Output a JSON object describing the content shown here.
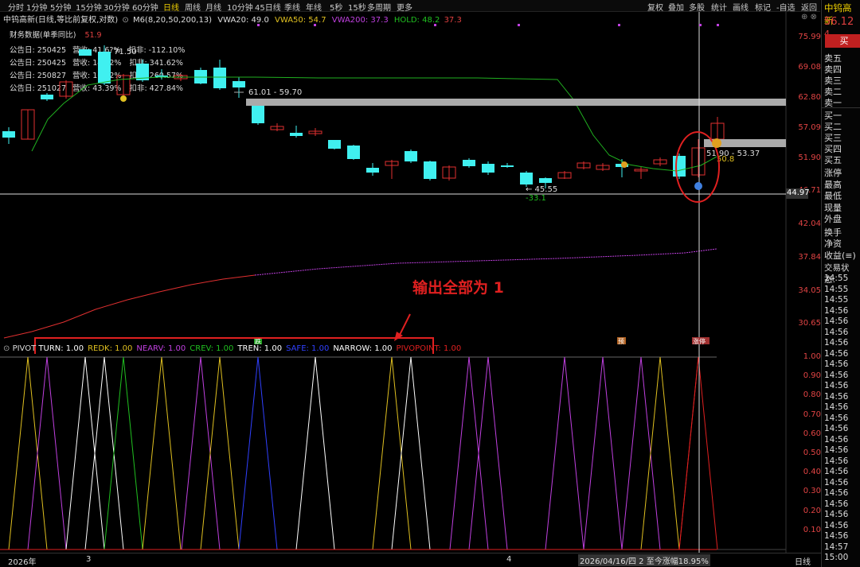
{
  "toolbar": {
    "left_items": [
      "分时",
      "1分钟",
      "5分钟",
      "15分钟",
      "30分钟",
      "60分钟",
      "日线",
      "周线",
      "月线",
      "10分钟",
      "45日线",
      "季线",
      "年线",
      "5秒",
      "15秒",
      "多周期",
      "更多"
    ],
    "active": "日线",
    "right_items": [
      "复权",
      "叠加",
      "多股",
      "统计",
      "画线",
      "标记",
      "-自选",
      "返回"
    ]
  },
  "chart_header": {
    "title": "中钨高新(日线,等比前复权,对数)",
    "indicator": "M6(8,20,50,200,13)",
    "vwa20": "VWA20: 49.0",
    "vwa50": "VWA50: 54.7",
    "vwa200": "VWA200: 37.3",
    "hold": "HOLD: 48.2",
    "hold2": "37.3"
  },
  "financial": {
    "title": "财务数据(单季同比)",
    "value": "51.9",
    "rows": [
      {
        "date": "公告日: 250425",
        "rev": "营收: 41.6?%",
        "deduct": "扣非: -112.10%"
      },
      {
        "date": "公告日: 250425",
        "rev": "营收: 14.52%",
        "deduct": "扣非: 341.62%"
      },
      {
        "date": "公告日: 250827",
        "rev": "营收: 16.02%",
        "deduct": "扣非: 260.57%"
      },
      {
        "date": "公告日: 251027",
        "rev": "营收: 43.39%",
        "deduct": "扣非: 427.84%"
      }
    ]
  },
  "price_axis": [
    "75.99",
    "69.08",
    "62.80",
    "57.09",
    "51.90",
    "46.71",
    "42.04",
    "37.84",
    "34.05",
    "30.65"
  ],
  "current_price_tag": "44.97",
  "annotations": {
    "range1": "61.01 - 59.70",
    "range2": "51.90 - 53.37",
    "small_val": "50.8",
    "low_label": "45.55",
    "low_pct": "-33.1",
    "extra_label": "71.50",
    "arrow_text": "输出全部为 1"
  },
  "markers": {
    "green_tag": "跌",
    "orange_tag": "预",
    "red_tag": "涨停"
  },
  "pivot": {
    "title": "PIVOT",
    "legend": [
      {
        "label": "TURN: 1.00",
        "color": "#ffffff"
      },
      {
        "label": "REDK: 1.00",
        "color": "#e0c020"
      },
      {
        "label": "NEARV: 1.00",
        "color": "#c040e0"
      },
      {
        "label": "CREV: 1.00",
        "color": "#20c020"
      },
      {
        "label": "TREN: 1.00",
        "color": "#ffffff"
      },
      {
        "label": "SAFE: 1.00",
        "color": "#3040ff"
      },
      {
        "label": "NARROW: 1.00",
        "color": "#ffffff"
      },
      {
        "label": "PIVOPOINT: 1.00",
        "color": "#e02020"
      }
    ],
    "axis": [
      "1.00",
      "0.90",
      "0.80",
      "0.70",
      "0.60",
      "0.50",
      "0.40",
      "0.30",
      "0.20",
      "0.10"
    ]
  },
  "bottom": {
    "year": "2026年",
    "m3": "3",
    "m4": "4",
    "status": "2026/04/16/四 2 至今涨幅18.95%",
    "period": "日线"
  },
  "right_panel": {
    "name": "中钨高新",
    "price": "56.12",
    "price2": "4",
    "buy_button": "买",
    "sells": [
      "卖五",
      "卖四",
      "卖三",
      "卖二",
      "卖一"
    ],
    "buys": [
      "买一",
      "买二",
      "买三",
      "买四",
      "买五"
    ],
    "stats": [
      "涨停",
      "最高",
      "最低",
      "现量",
      "外盘"
    ],
    "stats2": [
      "换手",
      "净资",
      "收益(≡)"
    ],
    "trade_status": "交易状态:",
    "times": [
      "14:55",
      "14:55",
      "14:55",
      "14:56",
      "14:56",
      "14:56",
      "14:56",
      "14:56",
      "14:56",
      "14:56",
      "14:56",
      "14:56",
      "14:56",
      "14:56",
      "14:56",
      "14:56",
      "14:56",
      "14:56",
      "14:56",
      "14:56",
      "14:56",
      "14:56",
      "14:56",
      "14:56",
      "14:56",
      "14:57",
      "15:00"
    ]
  },
  "colors": {
    "up": "#e03030",
    "down": "#40f0f0",
    "vwa20": "#20b020",
    "vwa200": "#c040e0",
    "accent": "#f0d000"
  }
}
